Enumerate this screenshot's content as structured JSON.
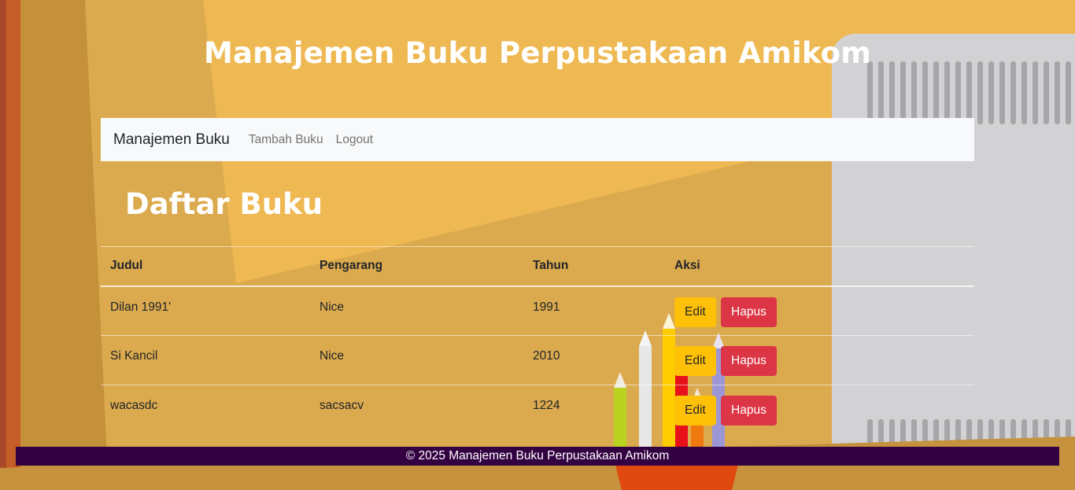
{
  "header": {
    "title": "Manajemen Buku Perpustakaan Amikom"
  },
  "navbar": {
    "brand": "Manajemen Buku",
    "links": [
      {
        "label": "Tambah Buku"
      },
      {
        "label": "Logout"
      }
    ]
  },
  "main": {
    "title": "Daftar Buku",
    "table": {
      "headers": [
        "Judul",
        "Pengarang",
        "Tahun",
        "Aksi"
      ],
      "rows": [
        {
          "judul": "Dilan 1991'",
          "pengarang": "Nice",
          "tahun": "1991",
          "edit": "Edit",
          "hapus": "Hapus"
        },
        {
          "judul": "Si Kancil",
          "pengarang": "Nice",
          "tahun": "2010",
          "edit": "Edit",
          "hapus": "Hapus"
        },
        {
          "judul": "wacasdc",
          "pengarang": "sacsacv",
          "tahun": "1224",
          "edit": "Edit",
          "hapus": "Hapus"
        }
      ]
    }
  },
  "footer": {
    "text": "© 2025 Manajemen Buku Perpustakaan Amikom"
  },
  "colors": {
    "background": "#dcaa4e",
    "navbar": "#f8f9fa",
    "edit_button": "#ffc107",
    "delete_button": "#dc3545",
    "footer": "#330042"
  }
}
